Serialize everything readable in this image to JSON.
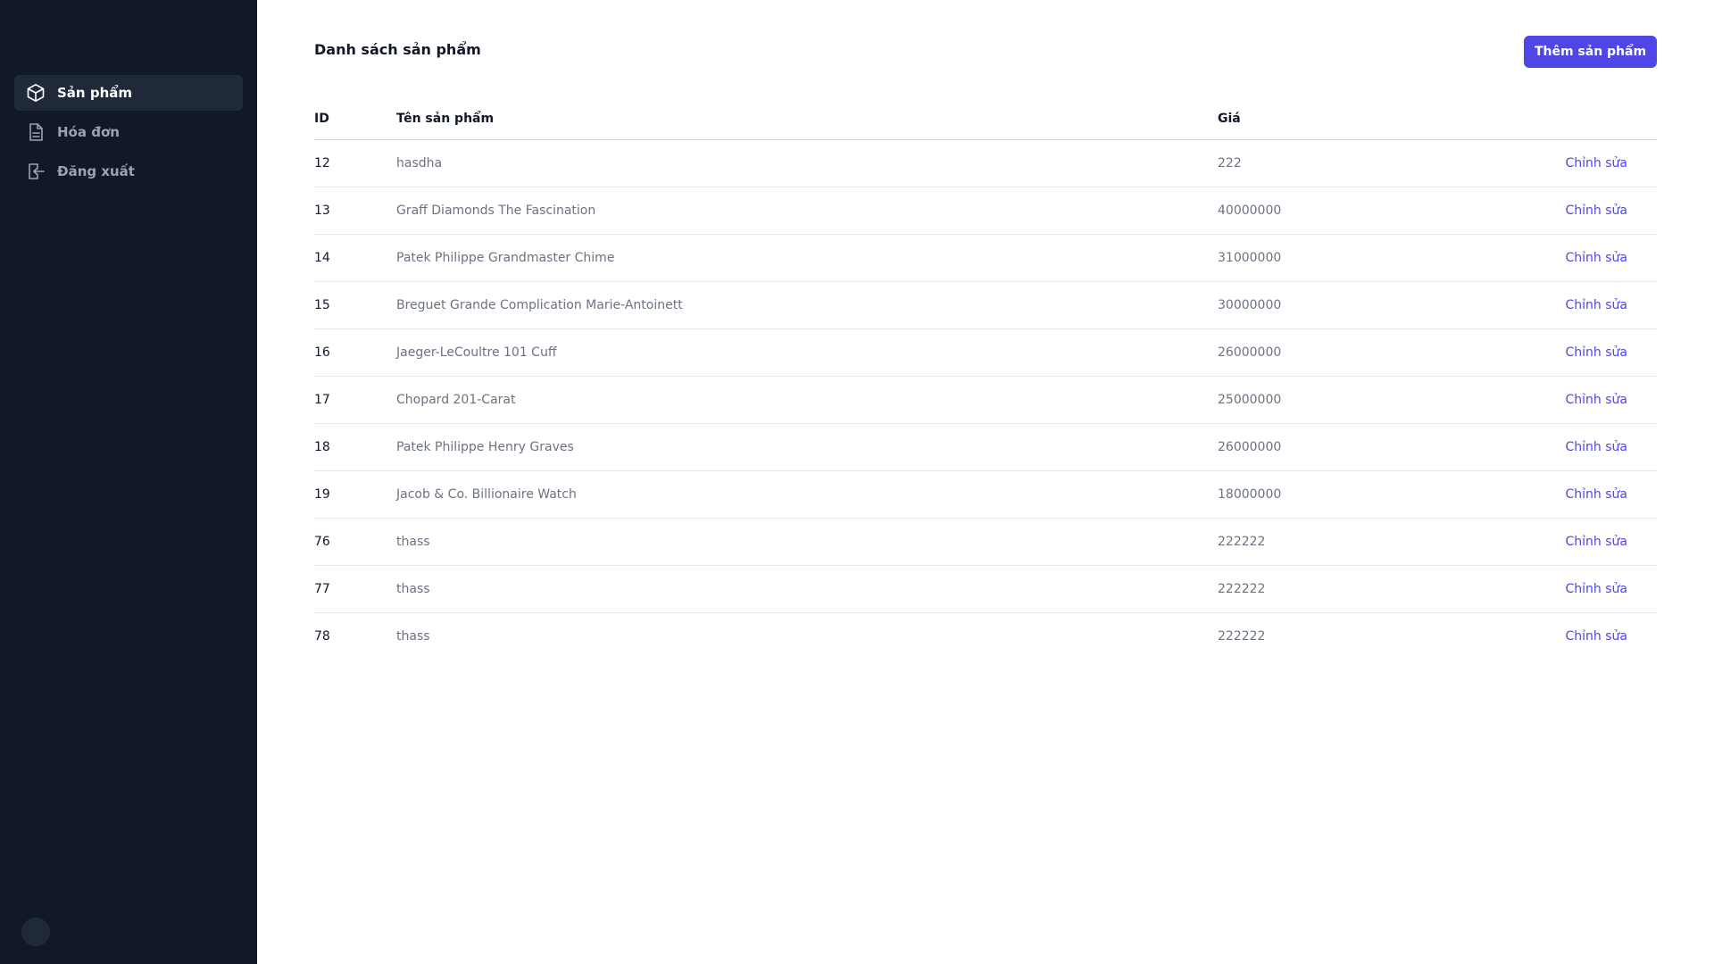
{
  "sidebar": {
    "items": [
      {
        "label": "Sản phẩm",
        "icon": "cube-icon",
        "active": true
      },
      {
        "label": "Hóa đơn",
        "icon": "document-icon",
        "active": false
      },
      {
        "label": "Đăng xuất",
        "icon": "logout-icon",
        "active": false
      }
    ]
  },
  "main": {
    "title": "Danh sách sản phẩm",
    "add_button_label": "Thêm sản phẩm"
  },
  "table": {
    "headers": {
      "id": "ID",
      "name": "Tên sản phẩm",
      "price": "Giá",
      "action": ""
    },
    "rows": [
      {
        "id": "12",
        "name": "hasdha",
        "price": "222",
        "action": "Chỉnh sửa"
      },
      {
        "id": "13",
        "name": "Graff Diamonds The Fascination",
        "price": "40000000",
        "action": "Chỉnh sửa"
      },
      {
        "id": "14",
        "name": "Patek Philippe Grandmaster Chime",
        "price": "31000000",
        "action": "Chỉnh sửa"
      },
      {
        "id": "15",
        "name": "Breguet Grande Complication Marie-Antoinett",
        "price": "30000000",
        "action": "Chỉnh sửa"
      },
      {
        "id": "16",
        "name": "Jaeger-LeCoultre 101 Cuff",
        "price": "26000000",
        "action": "Chỉnh sửa"
      },
      {
        "id": "17",
        "name": "Chopard 201-Carat",
        "price": "25000000",
        "action": "Chỉnh sửa"
      },
      {
        "id": "18",
        "name": "Patek Philippe Henry Graves",
        "price": "26000000",
        "action": "Chỉnh sửa"
      },
      {
        "id": "19",
        "name": "Jacob & Co. Billionaire Watch",
        "price": "18000000",
        "action": "Chỉnh sửa"
      },
      {
        "id": "76",
        "name": "thass",
        "price": "222222",
        "action": "Chỉnh sửa"
      },
      {
        "id": "77",
        "name": "thass",
        "price": "222222",
        "action": "Chỉnh sửa"
      },
      {
        "id": "78",
        "name": "thass",
        "price": "222222",
        "action": "Chỉnh sửa"
      }
    ]
  },
  "colors": {
    "sidebar_bg": "#111827",
    "sidebar_active_bg": "#1f2937",
    "accent": "#4f46e5"
  }
}
